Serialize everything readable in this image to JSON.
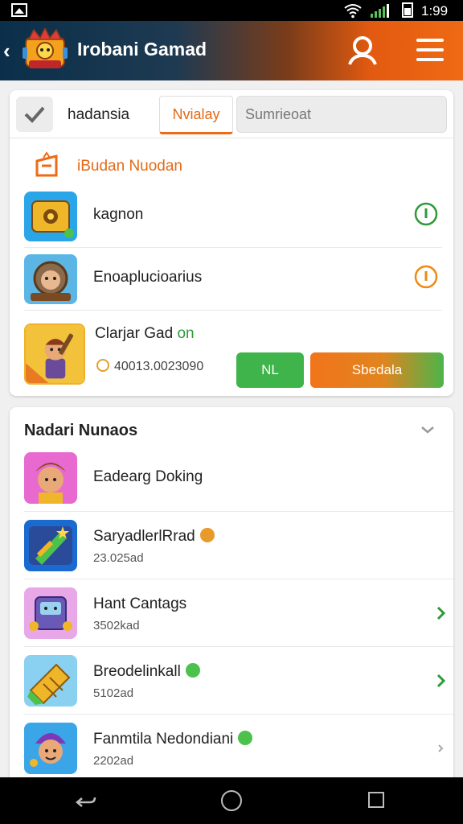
{
  "status_bar": {
    "time": "1:99"
  },
  "header": {
    "title": "Irobani Gamad"
  },
  "filters": {
    "check_label": "hadansia",
    "active_tab": "Nvialay",
    "search_placeholder": "Sumrieoat"
  },
  "section": {
    "title": "iBudan Nuodan",
    "games": [
      {
        "name": "kagnon",
        "status_color": "#2f9a3a"
      },
      {
        "name": "Enoaplucioarius",
        "status_color": "#ef8a14"
      }
    ],
    "featured": {
      "title_main": "Clarjar Gad",
      "title_accent": "on",
      "meta": "40013.0023090",
      "nl_label": "NL",
      "play_label": "Sbedala"
    }
  },
  "list": {
    "title": "Nadari Nunaos",
    "items": [
      {
        "title": "Eadearg Doking",
        "subtitle": ""
      },
      {
        "title": "SaryadlerlRrad",
        "subtitle": "23.025ad"
      },
      {
        "title": "Hant Cantags",
        "subtitle": "3502kad"
      },
      {
        "title": "Breodelinkall",
        "subtitle": "5102ad"
      },
      {
        "title": "Fanmtila Nedondiani",
        "subtitle": "2202ad"
      }
    ]
  },
  "colors": {
    "accent": "#ef6a14",
    "header_dark": "#0b2f4a",
    "success": "#3fb44a"
  }
}
